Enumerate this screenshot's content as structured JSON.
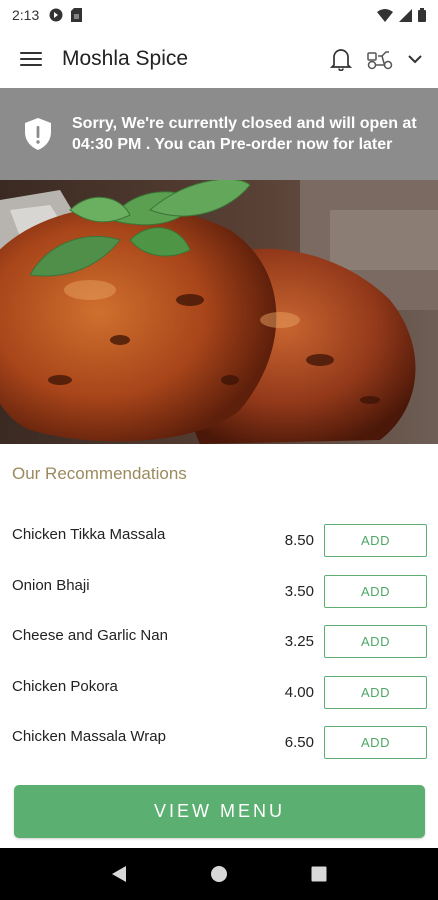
{
  "status_bar": {
    "time": "2:13",
    "icons": [
      "app-notification-icon",
      "sim-card-icon",
      "wifi-icon",
      "signal-icon",
      "battery-icon"
    ]
  },
  "app_bar": {
    "title": "Moshla Spice",
    "icons": [
      "hamburger-menu-icon",
      "bell-icon",
      "delivery-scooter-icon",
      "chevron-down-icon"
    ]
  },
  "closed_banner": {
    "message": "Sorry, We're currently closed and will open at 04:30 PM . You can Pre-order now for later",
    "icon": "shield-alert-icon"
  },
  "recommendations": {
    "title": "Our Recommendations",
    "add_label": "ADD",
    "items": [
      {
        "name": "Chicken Tikka Massala",
        "price": "8.50"
      },
      {
        "name": "Onion Bhaji",
        "price": "3.50"
      },
      {
        "name": "Cheese and Garlic Nan",
        "price": "3.25"
      },
      {
        "name": "Chicken Pokora",
        "price": "4.00"
      },
      {
        "name": "Chicken Massala Wrap",
        "price": "6.50"
      }
    ]
  },
  "view_menu_label": "VIEW MENU",
  "colors": {
    "banner": "#8c8c8c",
    "accent_green": "#5bb071",
    "section_title": "#9b8a5e"
  },
  "nav_bar": {
    "icons": [
      "back-icon",
      "home-icon",
      "recents-icon"
    ]
  }
}
